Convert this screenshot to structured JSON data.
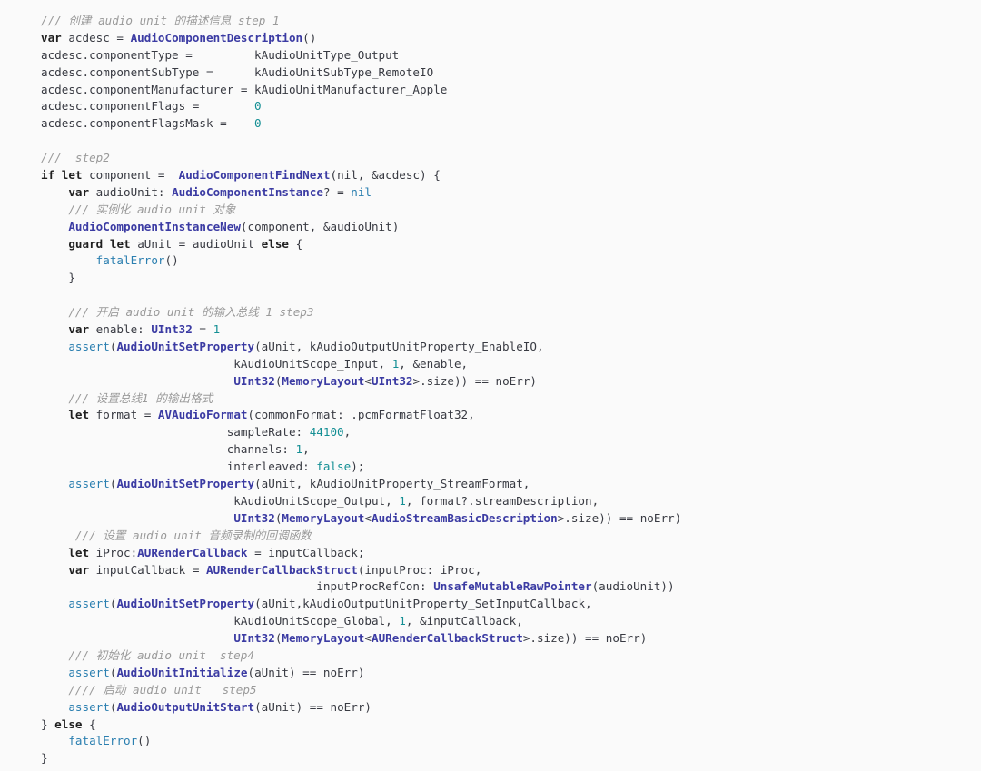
{
  "code": {
    "lines": [
      [
        [
          "comment",
          "/// 创建 audio unit 的描述信息 step 1"
        ]
      ],
      [
        [
          "kw",
          "var"
        ],
        [
          "plain",
          " acdesc = "
        ],
        [
          "type",
          "AudioComponentDescription"
        ],
        [
          "plain",
          "()"
        ]
      ],
      [
        [
          "plain",
          "acdesc.componentType =         kAudioUnitType_Output"
        ]
      ],
      [
        [
          "plain",
          "acdesc.componentSubType =      kAudioUnitSubType_RemoteIO"
        ]
      ],
      [
        [
          "plain",
          "acdesc.componentManufacturer = kAudioUnitManufacturer_Apple"
        ]
      ],
      [
        [
          "plain",
          "acdesc.componentFlags =        "
        ],
        [
          "num",
          "0"
        ]
      ],
      [
        [
          "plain",
          "acdesc.componentFlagsMask =    "
        ],
        [
          "num",
          "0"
        ]
      ],
      [],
      [
        [
          "comment",
          "///  step2"
        ]
      ],
      [
        [
          "kw",
          "if"
        ],
        [
          "plain",
          " "
        ],
        [
          "kw",
          "let"
        ],
        [
          "plain",
          " component =  "
        ],
        [
          "type",
          "AudioComponentFindNext"
        ],
        [
          "plain",
          "(nil, &acdesc) {"
        ]
      ],
      [
        [
          "plain",
          "    "
        ],
        [
          "kw",
          "var"
        ],
        [
          "plain",
          " audioUnit: "
        ],
        [
          "type",
          "AudioComponentInstance"
        ],
        [
          "plain",
          "? = "
        ],
        [
          "call",
          "nil"
        ]
      ],
      [
        [
          "plain",
          "    "
        ],
        [
          "comment",
          "/// 实例化 audio unit 对象"
        ]
      ],
      [
        [
          "plain",
          "    "
        ],
        [
          "type",
          "AudioComponentInstanceNew"
        ],
        [
          "plain",
          "(component, &audioUnit)"
        ]
      ],
      [
        [
          "plain",
          "    "
        ],
        [
          "kw",
          "guard"
        ],
        [
          "plain",
          " "
        ],
        [
          "kw",
          "let"
        ],
        [
          "plain",
          " aUnit = audioUnit "
        ],
        [
          "kw",
          "else"
        ],
        [
          "plain",
          " {"
        ]
      ],
      [
        [
          "plain",
          "        "
        ],
        [
          "call",
          "fatalError"
        ],
        [
          "plain",
          "()"
        ]
      ],
      [
        [
          "plain",
          "    }"
        ]
      ],
      [],
      [
        [
          "plain",
          "    "
        ],
        [
          "comment",
          "/// 开启 audio unit 的输入总线 1 step3"
        ]
      ],
      [
        [
          "plain",
          "    "
        ],
        [
          "kw",
          "var"
        ],
        [
          "plain",
          " enable: "
        ],
        [
          "type",
          "UInt32"
        ],
        [
          "plain",
          " = "
        ],
        [
          "num",
          "1"
        ]
      ],
      [
        [
          "plain",
          "    "
        ],
        [
          "call",
          "assert"
        ],
        [
          "plain",
          "("
        ],
        [
          "type",
          "AudioUnitSetProperty"
        ],
        [
          "plain",
          "(aUnit, kAudioOutputUnitProperty_EnableIO,"
        ]
      ],
      [
        [
          "plain",
          "                            kAudioUnitScope_Input, "
        ],
        [
          "num",
          "1"
        ],
        [
          "plain",
          ", &enable,"
        ]
      ],
      [
        [
          "plain",
          "                            "
        ],
        [
          "type",
          "UInt32"
        ],
        [
          "plain",
          "("
        ],
        [
          "type",
          "MemoryLayout"
        ],
        [
          "plain",
          "<"
        ],
        [
          "type",
          "UInt32"
        ],
        [
          "plain",
          ">.size)) == noErr)"
        ]
      ],
      [
        [
          "plain",
          "    "
        ],
        [
          "comment",
          "/// 设置总线1 的输出格式"
        ]
      ],
      [
        [
          "plain",
          "    "
        ],
        [
          "kw",
          "let"
        ],
        [
          "plain",
          " format = "
        ],
        [
          "type",
          "AVAudioFormat"
        ],
        [
          "plain",
          "(commonFormat: .pcmFormatFloat32,"
        ]
      ],
      [
        [
          "plain",
          "                           sampleRate: "
        ],
        [
          "num",
          "44100"
        ],
        [
          "plain",
          ","
        ]
      ],
      [
        [
          "plain",
          "                           channels: "
        ],
        [
          "num",
          "1"
        ],
        [
          "plain",
          ","
        ]
      ],
      [
        [
          "plain",
          "                           interleaved: "
        ],
        [
          "num",
          "false"
        ],
        [
          "plain",
          ");"
        ]
      ],
      [
        [
          "plain",
          "    "
        ],
        [
          "call",
          "assert"
        ],
        [
          "plain",
          "("
        ],
        [
          "type",
          "AudioUnitSetProperty"
        ],
        [
          "plain",
          "(aUnit, kAudioUnitProperty_StreamFormat,"
        ]
      ],
      [
        [
          "plain",
          "                            kAudioUnitScope_Output, "
        ],
        [
          "num",
          "1"
        ],
        [
          "plain",
          ", format?.streamDescription,"
        ]
      ],
      [
        [
          "plain",
          "                            "
        ],
        [
          "type",
          "UInt32"
        ],
        [
          "plain",
          "("
        ],
        [
          "type",
          "MemoryLayout"
        ],
        [
          "plain",
          "<"
        ],
        [
          "type",
          "AudioStreamBasicDescription"
        ],
        [
          "plain",
          ">.size)) == noErr)"
        ]
      ],
      [
        [
          "plain",
          "     "
        ],
        [
          "comment",
          "/// 设置 audio unit 音频录制的回调函数"
        ]
      ],
      [
        [
          "plain",
          "    "
        ],
        [
          "kw",
          "let"
        ],
        [
          "plain",
          " iProc:"
        ],
        [
          "type",
          "AURenderCallback"
        ],
        [
          "plain",
          " = inputCallback;"
        ]
      ],
      [
        [
          "plain",
          "    "
        ],
        [
          "kw",
          "var"
        ],
        [
          "plain",
          " inputCallback = "
        ],
        [
          "type",
          "AURenderCallbackStruct"
        ],
        [
          "plain",
          "(inputProc: iProc,"
        ]
      ],
      [
        [
          "plain",
          "                                        inputProcRefCon: "
        ],
        [
          "type",
          "UnsafeMutableRawPointer"
        ],
        [
          "plain",
          "(audioUnit))"
        ]
      ],
      [
        [
          "plain",
          "    "
        ],
        [
          "call",
          "assert"
        ],
        [
          "plain",
          "("
        ],
        [
          "type",
          "AudioUnitSetProperty"
        ],
        [
          "plain",
          "(aUnit,kAudioOutputUnitProperty_SetInputCallback,"
        ]
      ],
      [
        [
          "plain",
          "                            kAudioUnitScope_Global, "
        ],
        [
          "num",
          "1"
        ],
        [
          "plain",
          ", &inputCallback,"
        ]
      ],
      [
        [
          "plain",
          "                            "
        ],
        [
          "type",
          "UInt32"
        ],
        [
          "plain",
          "("
        ],
        [
          "type",
          "MemoryLayout"
        ],
        [
          "plain",
          "<"
        ],
        [
          "type",
          "AURenderCallbackStruct"
        ],
        [
          "plain",
          ">.size)) == noErr)"
        ]
      ],
      [
        [
          "plain",
          "    "
        ],
        [
          "comment",
          "/// 初始化 audio unit  step4"
        ]
      ],
      [
        [
          "plain",
          "    "
        ],
        [
          "call",
          "assert"
        ],
        [
          "plain",
          "("
        ],
        [
          "type",
          "AudioUnitInitialize"
        ],
        [
          "plain",
          "(aUnit) == noErr)"
        ]
      ],
      [
        [
          "plain",
          "    "
        ],
        [
          "comment",
          "//// 启动 audio unit   step5"
        ]
      ],
      [
        [
          "plain",
          "    "
        ],
        [
          "call",
          "assert"
        ],
        [
          "plain",
          "("
        ],
        [
          "type",
          "AudioOutputUnitStart"
        ],
        [
          "plain",
          "(aUnit) == noErr)"
        ]
      ],
      [
        [
          "plain",
          "} "
        ],
        [
          "kw",
          "else"
        ],
        [
          "plain",
          " {"
        ]
      ],
      [
        [
          "plain",
          "    "
        ],
        [
          "call",
          "fatalError"
        ],
        [
          "plain",
          "()"
        ]
      ],
      [
        [
          "plain",
          "}"
        ]
      ]
    ]
  }
}
